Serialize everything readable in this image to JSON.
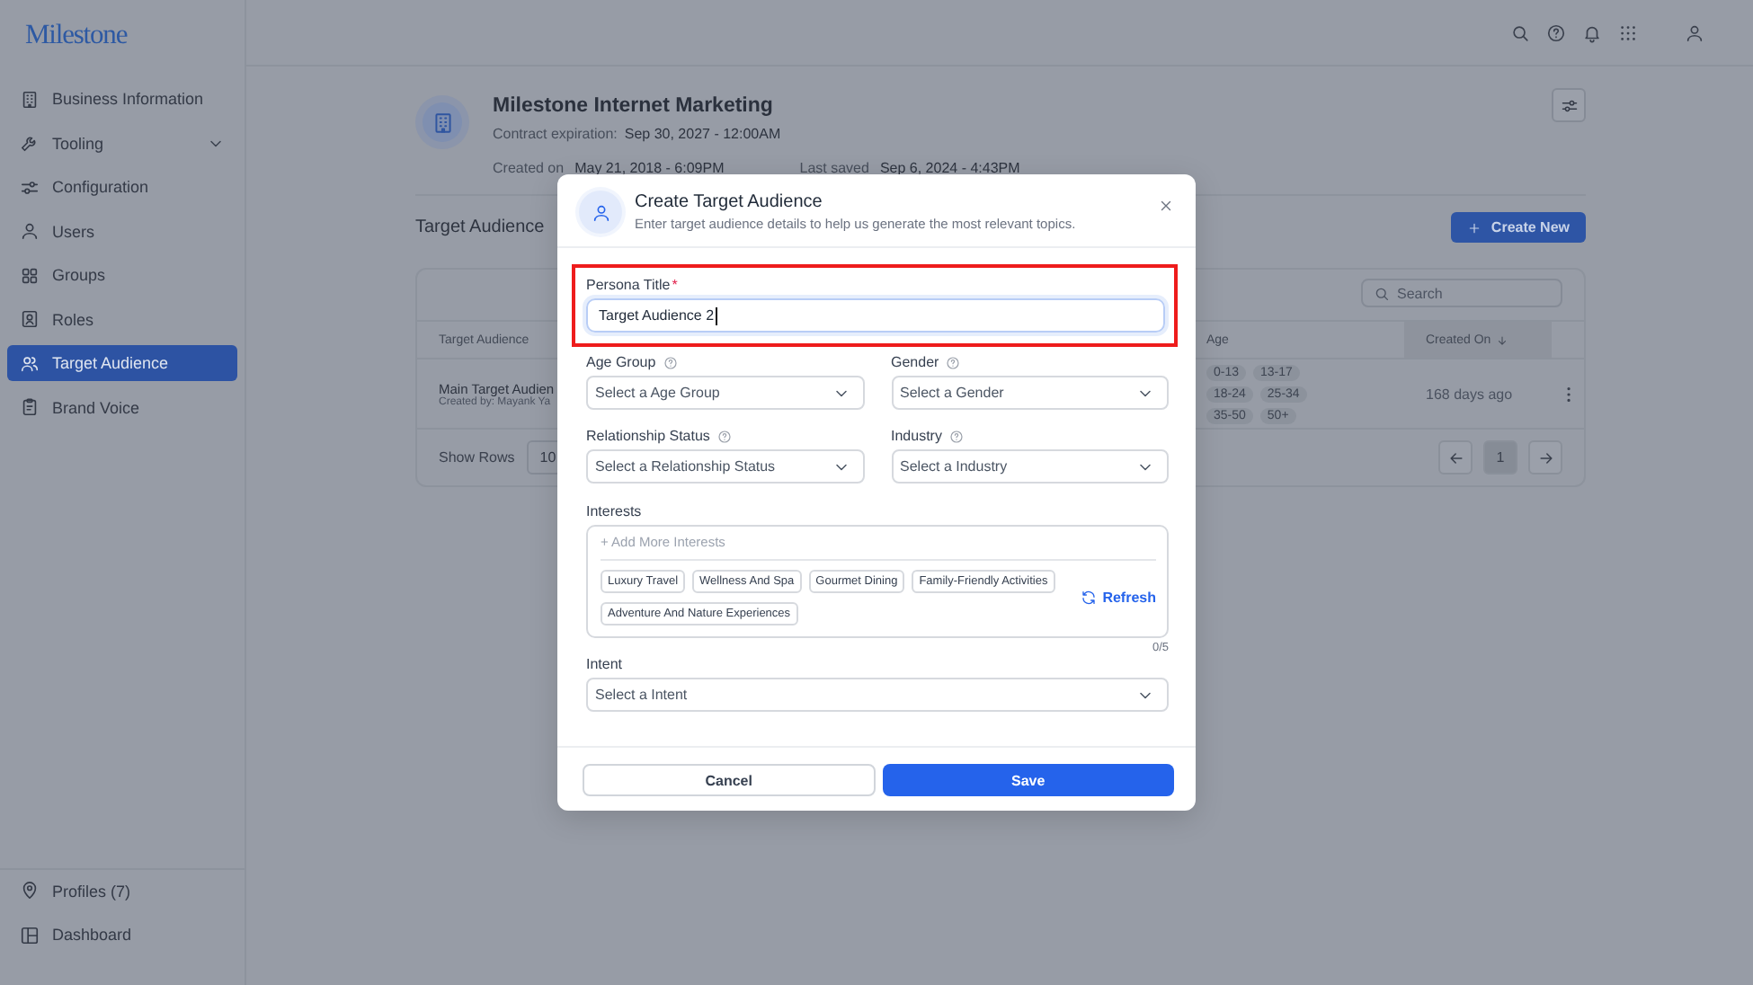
{
  "brand": {
    "logo": "Milestone"
  },
  "sidebar": {
    "items": [
      {
        "label": "Business Information",
        "kind": "link",
        "selected": false
      },
      {
        "label": "Tooling",
        "kind": "group",
        "selected": false
      },
      {
        "label": "Configuration",
        "kind": "link",
        "selected": false
      },
      {
        "label": "Users",
        "kind": "link",
        "selected": false
      },
      {
        "label": "Groups",
        "kind": "link",
        "selected": false
      },
      {
        "label": "Roles",
        "kind": "link",
        "selected": false
      },
      {
        "label": "Target Audience",
        "kind": "link",
        "selected": true
      },
      {
        "label": "Brand Voice",
        "kind": "link",
        "selected": false
      }
    ],
    "footer_items": [
      {
        "label": "Profiles (7)"
      },
      {
        "label": "Dashboard"
      }
    ]
  },
  "business": {
    "name": "Milestone Internet Marketing",
    "contract_label": "Contract expiration:",
    "contract_value": "Sep 30, 2027 - 12:00AM",
    "created_label": "Created on",
    "created_value": "May 21, 2018 - 6:09PM",
    "saved_label": "Last saved",
    "saved_value": "Sep 6, 2024 - 4:43PM"
  },
  "section": {
    "title": "Target Audience",
    "create_button": "Create New"
  },
  "table": {
    "search_placeholder": "Search",
    "columns": [
      "Target Audience",
      "Age",
      "Created On"
    ],
    "rows": [
      {
        "name": "Main Target Audien",
        "created_by": "Created by: Mayank Ya",
        "ages": [
          "0-13",
          "13-17",
          "18-24",
          "25-34",
          "35-50",
          "50+"
        ],
        "created_on": "168 days ago"
      }
    ],
    "show_rows_label": "Show Rows",
    "rows_per_page": "10",
    "pages": [
      {
        "label": "1",
        "selected": true
      }
    ]
  },
  "modal": {
    "title": "Create Target Audience",
    "subtitle": "Enter target audience details to help us generate the most relevant topics.",
    "persona": {
      "label": "Persona Title",
      "required_mark": "*",
      "value": "Target Audience 2",
      "highlighted": true
    },
    "selects": [
      {
        "label": "Age Group",
        "placeholder": "Select a Age Group",
        "help": true
      },
      {
        "label": "Gender",
        "placeholder": "Select a Gender",
        "help": true
      },
      {
        "label": "Relationship Status",
        "placeholder": "Select a Relationship Status",
        "help": true
      },
      {
        "label": "Industry",
        "placeholder": "Select a Industry",
        "help": true
      }
    ],
    "interests": {
      "label": "Interests",
      "placeholder": "+ Add More Interests",
      "suggestions": [
        "Luxury Travel",
        "Wellness And Spa",
        "Gourmet Dining",
        "Family-Friendly Activities",
        "Adventure And Nature Experiences"
      ],
      "refresh": "Refresh",
      "count": "0/5"
    },
    "intent": {
      "label": "Intent",
      "placeholder": "Select a Intent"
    },
    "cancel": "Cancel",
    "save": "Save"
  }
}
